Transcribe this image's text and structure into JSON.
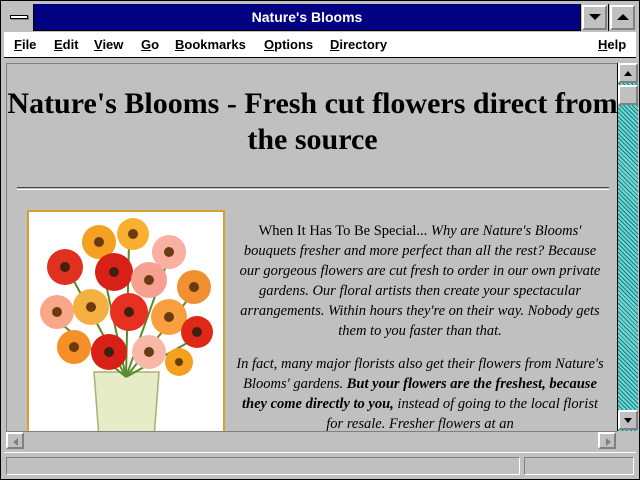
{
  "window": {
    "title": "Nature's Blooms"
  },
  "menubar": {
    "items": [
      {
        "label": "File",
        "accel": "F"
      },
      {
        "label": "Edit",
        "accel": "E"
      },
      {
        "label": "View",
        "accel": "V"
      },
      {
        "label": "Go",
        "accel": "G"
      },
      {
        "label": "Bookmarks",
        "accel": "B"
      },
      {
        "label": "Options",
        "accel": "O"
      },
      {
        "label": "Directory",
        "accel": "D"
      },
      {
        "label": "Help",
        "accel": "H"
      }
    ]
  },
  "page": {
    "heading": "Nature's Blooms - Fresh cut flowers direct from the source",
    "image": {
      "icon": "flower-bouquet-image"
    },
    "paragraph1": {
      "lead": "When It Has To Be Special...",
      "body": "Why are Nature's Blooms' bouquets fresher and more perfect than all the rest? Because our gorgeous flowers are cut fresh to order in our own private gardens. Our floral artists then create your spectacular arrangements. Within hours they're on their way. Nobody gets them to you faster than that."
    },
    "paragraph2": {
      "part1": "In fact, many major florists also get their flowers from Nature's Blooms' gardens.",
      "bold": "But your flowers are the freshest, because they come directly to you,",
      "part2": "instead of going to the local florist for resale. Fresher flowers at an"
    }
  },
  "colors": {
    "titlebar": "#000080",
    "window_bg": "#c0c0c0",
    "scroll_track": "#00a0a0",
    "photo_border": "#d8a030"
  }
}
